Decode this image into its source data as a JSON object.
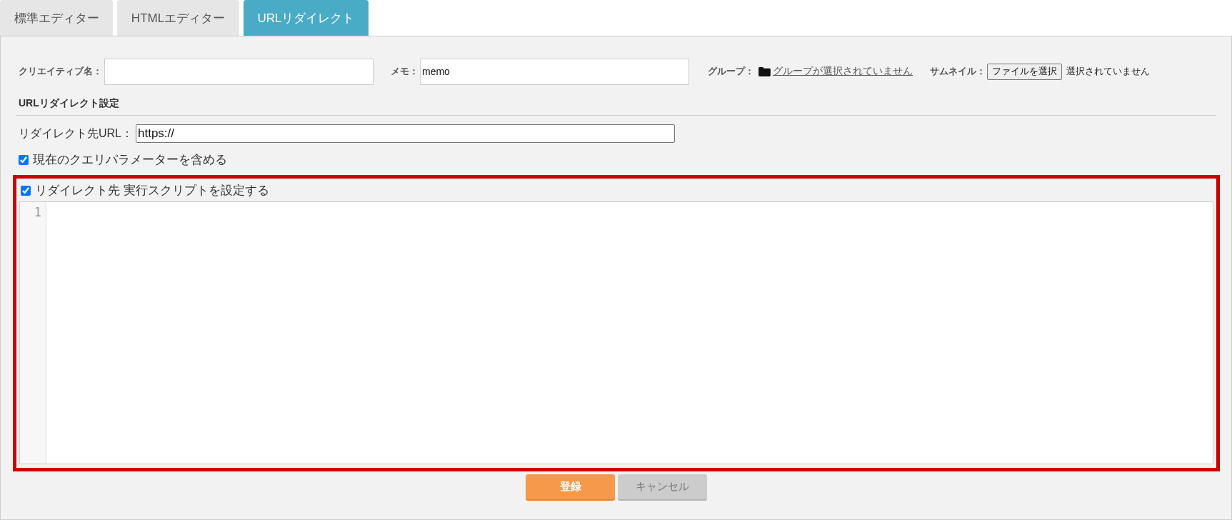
{
  "tabs": [
    {
      "label": "標準エディター",
      "selected": false
    },
    {
      "label": "HTMLエディター",
      "selected": false
    },
    {
      "label": "URLリダイレクト",
      "selected": true
    }
  ],
  "form": {
    "creative_name": {
      "label": "クリエイティブ名："
    },
    "memo": {
      "label": "メモ：",
      "value": "memo"
    },
    "group": {
      "label": "グループ：",
      "link": "グループが選択されていません"
    },
    "thumbnail": {
      "label": "サムネイル：",
      "button": "ファイルを選択",
      "status": "選択されていません"
    }
  },
  "redirect_settings": {
    "heading": "URLリダイレクト設定",
    "url": {
      "label": "リダイレクト先URL：",
      "value": "https://"
    },
    "query_checkbox": {
      "label": "現在のクエリパラメーターを含める",
      "checked": true
    }
  },
  "script_section": {
    "highlighted": true,
    "checkbox": {
      "label": "リダイレクト先 実行スクリプトを設定する",
      "checked": true
    },
    "editor": {
      "line_numbers": [
        "1"
      ]
    }
  },
  "buttons": [
    {
      "label": "登録",
      "kind": "primary"
    },
    {
      "label": "キャンセル",
      "kind": "secondary"
    }
  ]
}
